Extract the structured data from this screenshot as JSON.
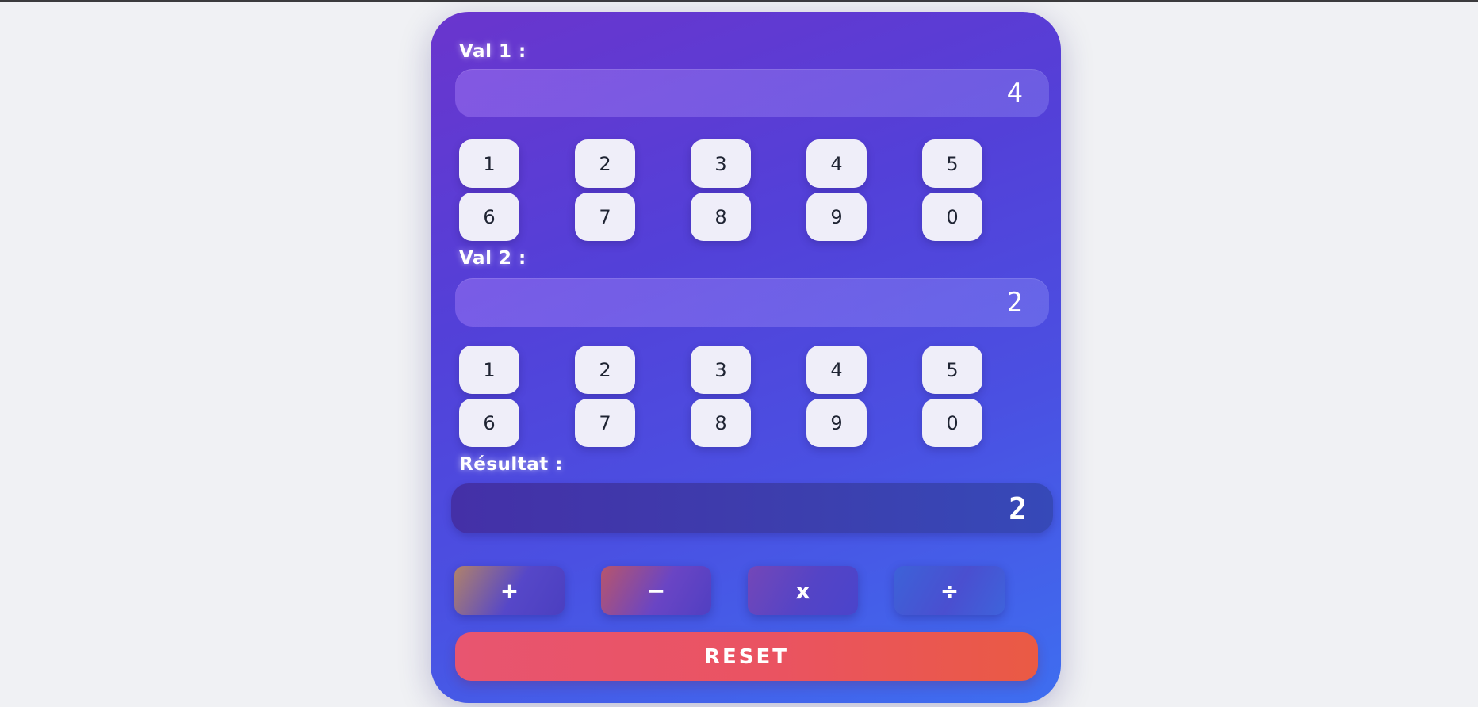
{
  "calculator": {
    "val1": {
      "label": "Val 1 :",
      "value": "4",
      "keys": [
        "1",
        "2",
        "3",
        "4",
        "5",
        "6",
        "7",
        "8",
        "9",
        "0"
      ]
    },
    "val2": {
      "label": "Val 2 :",
      "value": "2",
      "keys": [
        "1",
        "2",
        "3",
        "4",
        "5",
        "6",
        "7",
        "8",
        "9",
        "0"
      ]
    },
    "result": {
      "label": "Résultat :",
      "value": "2"
    },
    "operations": {
      "plus": "+",
      "minus": "−",
      "times": "x",
      "divide": "÷"
    },
    "reset_label": "RESET"
  },
  "colors": {
    "background": "#f0f1f4",
    "card_gradient_start": "#6a35cd",
    "card_gradient_end": "#3e6ef0",
    "key_bg": "#efeef9",
    "reset_start": "#e85570",
    "reset_end": "#ea5a44"
  }
}
